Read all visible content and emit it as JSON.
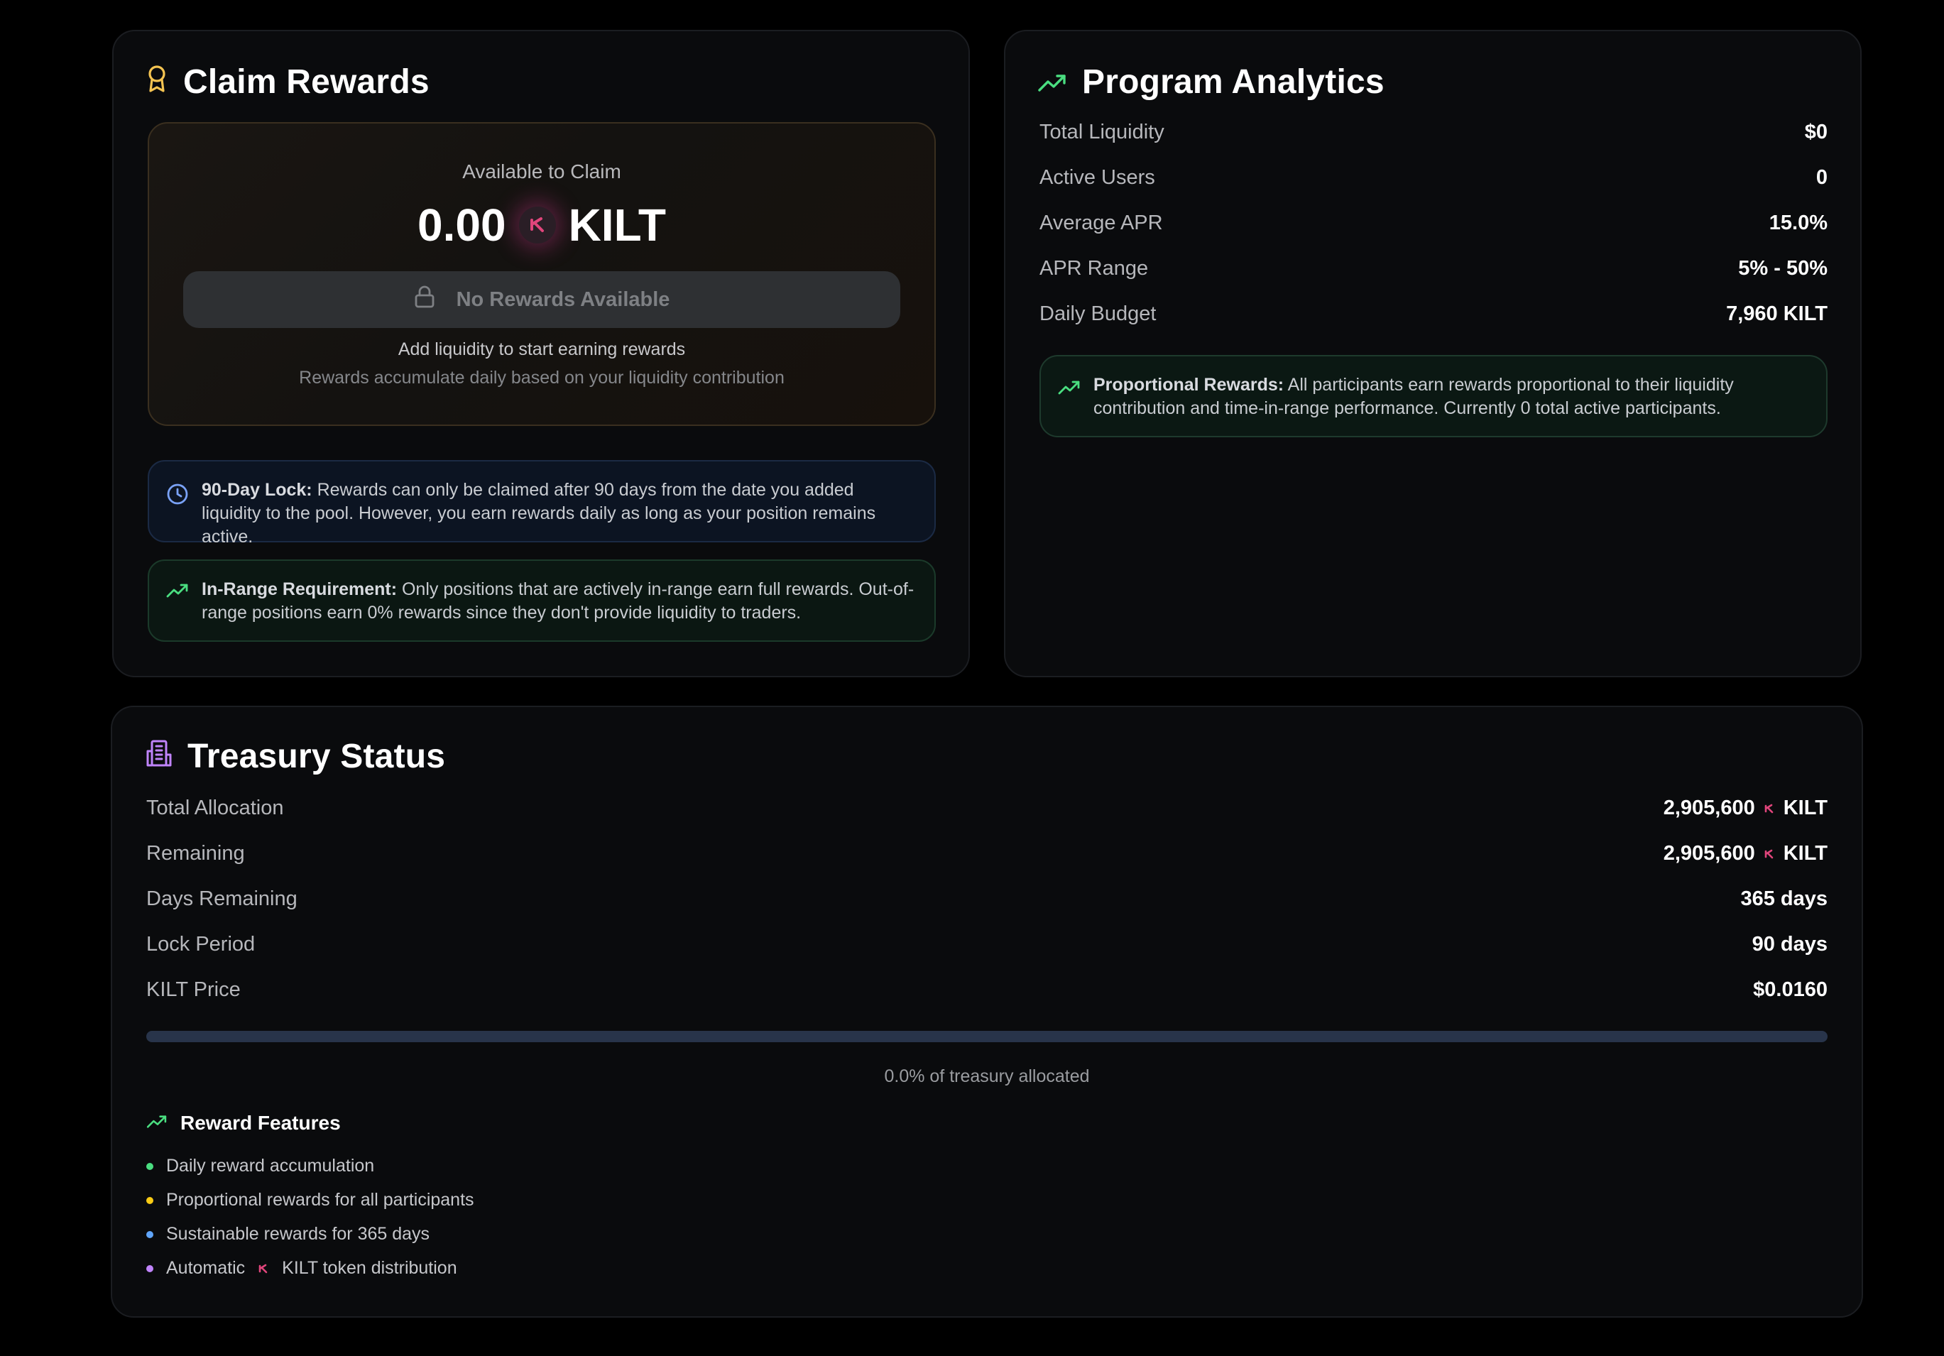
{
  "claim": {
    "title": "Claim Rewards",
    "available_label": "Available to Claim",
    "amount": "0.00",
    "token": "KILT",
    "button_label": "No Rewards Available",
    "hint_primary": "Add liquidity to start earning rewards",
    "hint_secondary": "Rewards accumulate daily based on your liquidity contribution",
    "lock_notice": {
      "title": "90-Day Lock:",
      "text": "Rewards can only be claimed after 90 days from the date you added liquidity to the pool. However, you earn rewards daily as long as your position remains active."
    },
    "range_notice": {
      "title": "In-Range Requirement:",
      "text": "Only positions that are actively in-range earn full rewards. Out-of-range positions earn 0% rewards since they don't provide liquidity to traders."
    }
  },
  "analytics": {
    "title": "Program Analytics",
    "rows": [
      {
        "label": "Total Liquidity",
        "value": "$0"
      },
      {
        "label": "Active Users",
        "value": "0"
      },
      {
        "label": "Average APR",
        "value": "15.0%"
      },
      {
        "label": "APR Range",
        "value": "5% - 50%"
      },
      {
        "label": "Daily Budget",
        "value": "7,960 KILT"
      }
    ],
    "proportional": {
      "title": "Proportional Rewards:",
      "text": "All participants earn rewards proportional to their liquidity contribution and time-in-range performance. Currently 0 total active participants."
    }
  },
  "treasury": {
    "title": "Treasury Status",
    "rows": [
      {
        "label": "Total Allocation",
        "value": "2,905,600",
        "token": "KILT"
      },
      {
        "label": "Remaining",
        "value": "2,905,600",
        "token": "KILT"
      },
      {
        "label": "Days Remaining",
        "value": "365 days"
      },
      {
        "label": "Lock Period",
        "value": "90 days"
      },
      {
        "label": "KILT Price",
        "value": "$0.0160"
      }
    ],
    "allocated_fraction": 0.0,
    "progress_caption": "0.0% of treasury allocated",
    "features_title": "Reward Features",
    "features": [
      {
        "text": "Daily reward accumulation",
        "color": "#4ade80"
      },
      {
        "text": "Proportional rewards for all participants",
        "color": "#facc15"
      },
      {
        "text": "Sustainable rewards for 365 days",
        "color": "#60a5fa"
      },
      {
        "text_before": "Automatic",
        "text_after": "KILT token distribution",
        "color": "#c084fc"
      }
    ]
  },
  "colors": {
    "kilt_pink": "#e0457b",
    "accent_green": "#4ade80",
    "award_yellow": "#f5c451",
    "clock_blue": "#7aa2f7",
    "building_purple": "#c084fc"
  },
  "icons": {
    "claim": "award-icon",
    "analytics": "trending-up-icon",
    "treasury": "building-icon",
    "lock": "lock-icon",
    "clock": "clock-icon",
    "kilt": "kilt-logo-icon"
  }
}
